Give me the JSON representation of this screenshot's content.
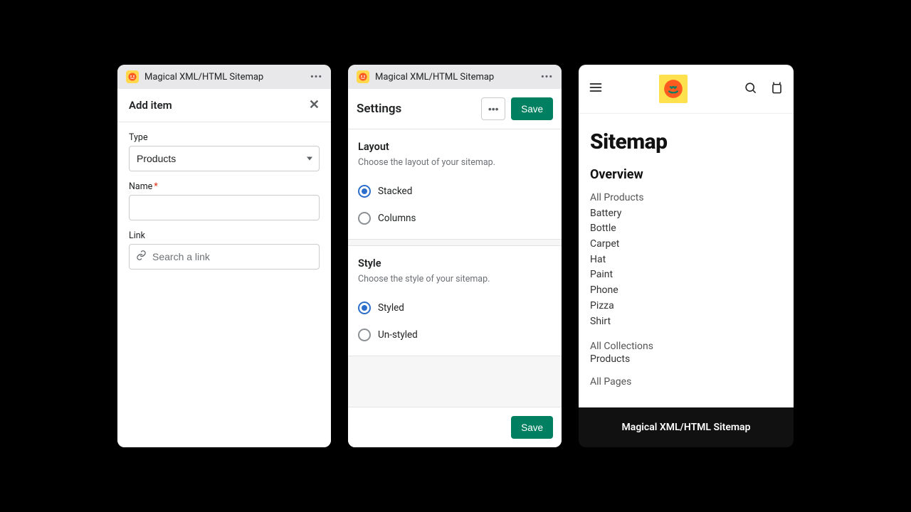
{
  "app_name": "Magical XML/HTML Sitemap",
  "accent_green": "#008060",
  "add_item_panel": {
    "title": "Add item",
    "type_label": "Type",
    "type_value": "Products",
    "name_label": "Name",
    "name_required": "*",
    "link_label": "Link",
    "link_placeholder": "Search a link"
  },
  "settings_panel": {
    "title": "Settings",
    "save_label": "Save",
    "layout": {
      "heading": "Layout",
      "description": "Choose the layout of your sitemap.",
      "options": {
        "stacked": "Stacked",
        "columns": "Columns"
      },
      "selected": "stacked"
    },
    "style": {
      "heading": "Style",
      "description": "Choose the style of your sitemap.",
      "options": {
        "styled": "Styled",
        "unstyled": "Un-styled"
      },
      "selected": "styled"
    },
    "footer_save_label": "Save"
  },
  "preview": {
    "page_title": "Sitemap",
    "overview_heading": "Overview",
    "all_products_label": "All Products",
    "products": [
      "Battery",
      "Bottle",
      "Carpet",
      "Hat",
      "Paint",
      "Phone",
      "Pizza",
      "Shirt"
    ],
    "all_collections_label": "All Collections",
    "collections": [
      "Products"
    ],
    "all_pages_label": "All Pages",
    "footer_text": "Magical XML/HTML Sitemap"
  }
}
